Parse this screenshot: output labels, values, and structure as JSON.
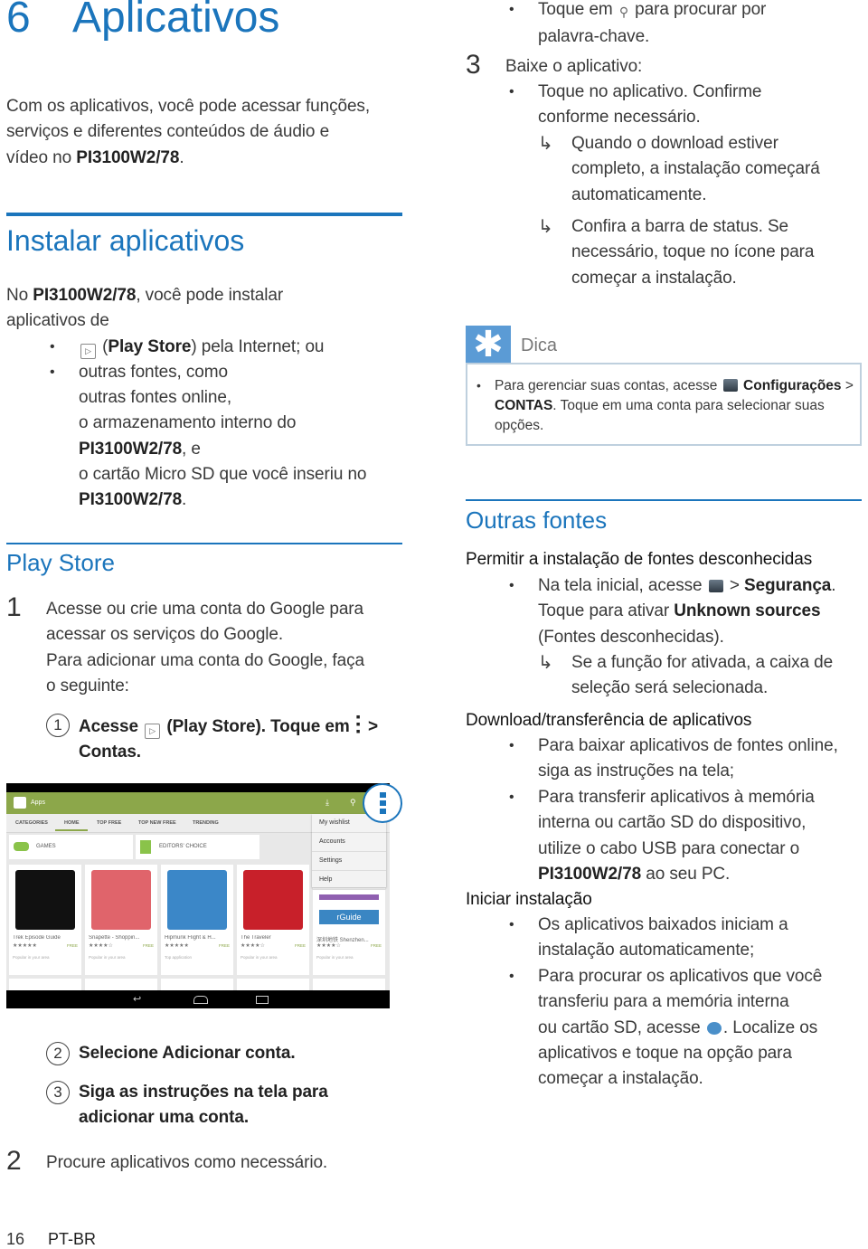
{
  "colors": {
    "accent": "#1b75bc",
    "tip_icon": "#5b9bd5",
    "store_bar": "#8ca74a"
  },
  "left": {
    "chapter_number": "6",
    "chapter_title": "Aplicativos",
    "intro": [
      [
        "Com os aplicativos, você pode acessar funções,"
      ],
      [
        "serviços e diferentes conteúdos de áudio e"
      ],
      [
        "vídeo no ",
        {
          "text": "PI3100W2/78",
          "bold": true
        },
        "."
      ]
    ],
    "install_heading": "Instalar aplicativos",
    "install_para": [
      [
        "No ",
        {
          "text": "PI3100W2/78",
          "bold": true
        },
        ", você pode instalar"
      ],
      [
        "aplicativos de"
      ]
    ],
    "install_item1": [
      [
        {
          "icon": "play-store-icon"
        },
        " (",
        {
          "text": "Play Store",
          "bold": true
        },
        ") pela Internet; ou"
      ]
    ],
    "install_item2": [
      [
        "outras fontes, como"
      ],
      [
        "outras fontes online,"
      ],
      [
        "o armazenamento interno do"
      ],
      [
        {
          "text": "PI3100W2/78",
          "bold": true
        },
        ", e"
      ],
      [
        "o cartão Micro SD que você inseriu no"
      ],
      [
        {
          "text": "PI3100W2/78",
          "bold": true
        },
        "."
      ]
    ],
    "playstore_heading": "Play Store",
    "step1_number": "1",
    "step1": [
      [
        "Acesse ou crie uma conta do Google para"
      ],
      [
        "acessar os serviços do Google."
      ],
      [
        "Para adicionar uma conta do Google, faça"
      ],
      [
        "o seguinte:"
      ]
    ],
    "sub1_number": "1",
    "sub1": [
      [
        {
          "text": "Acesse",
          "bold": true
        },
        " ",
        {
          "icon": "play-store-icon"
        },
        " ",
        {
          "text": "(Play Store). Toque em",
          "bold": true
        },
        " ",
        {
          "icon": "menu-icon"
        },
        " ",
        {
          "text": ">",
          "bold": true
        }
      ],
      [
        {
          "text": "Contas.",
          "bold": true
        }
      ]
    ],
    "sub2_number": "2",
    "sub2": [
      [
        {
          "text": "Selecione Adicionar conta.",
          "bold": true
        }
      ]
    ],
    "sub3_number": "3",
    "sub3": [
      [
        {
          "text": "Siga as instruções na tela para",
          "bold": true
        }
      ],
      [
        {
          "text": "adicionar uma conta.",
          "bold": true
        }
      ]
    ],
    "step2_number": "2",
    "step2": [
      [
        "Procure aplicativos como necessário."
      ]
    ]
  },
  "screenshot": {
    "title": "Apps",
    "tabs": [
      "CATEGORIES",
      "HOME",
      "TOP FREE",
      "TOP NEW FREE",
      "TRENDING"
    ],
    "categories": [
      "GAMES",
      "EDITORS' CHOICE"
    ],
    "menu": [
      "My wishlist",
      "Accounts",
      "Settings",
      "Help"
    ],
    "apps": [
      {
        "name": "Trek Episode Guide",
        "stars": "★★★★★",
        "price": "FREE",
        "note": "Popular in your area",
        "color": "#111"
      },
      {
        "name": "Snapette - Shoppin...",
        "stars": "★★★★☆",
        "price": "FREE",
        "note": "Popular in your area",
        "color": "#e0646b"
      },
      {
        "name": "Hipmunk Flight & H...",
        "stars": "★★★★★",
        "price": "FREE",
        "note": "Top application",
        "color": "#3b87c8"
      },
      {
        "name": "The Traveler",
        "stars": "★★★★☆",
        "price": "FREE",
        "note": "Popular in your area",
        "color": "#c8202a"
      },
      {
        "name": "深圳地铁 Shenzhen...",
        "stars": "★★★★☆",
        "price": "FREE",
        "note": "Popular in your area",
        "color": "#fff"
      }
    ],
    "app5_label": "rGuide",
    "app5_chars": "深圳"
  },
  "right": {
    "search_item": [
      [
        "Toque em ",
        {
          "icon": "search-icon"
        },
        " para procurar por"
      ],
      [
        "palavra-chave."
      ]
    ],
    "step3_number": "3",
    "step3": [
      [
        "Baixe o aplicativo:"
      ]
    ],
    "step3_item": [
      [
        "Toque no aplicativo. Confirme"
      ],
      [
        "conforme necessário."
      ]
    ],
    "step3_result1": [
      [
        "Quando o download estiver"
      ],
      [
        "completo, a instalação começará"
      ],
      [
        "automaticamente."
      ]
    ],
    "step3_result2": [
      [
        "Confira a barra de status. Se"
      ],
      [
        "necessário, toque no ícone para"
      ],
      [
        "começar a instalação."
      ]
    ],
    "tip_title": "Dica",
    "tip": [
      [
        "Para gerenciar suas contas, acesse ",
        {
          "icon": "settings-icon"
        },
        " ",
        {
          "text": "Configurações",
          "bold": true
        },
        " >"
      ],
      [
        {
          "text": "CONTAS",
          "bold": true
        },
        ". Toque em uma conta para selecionar suas"
      ],
      [
        "opções."
      ]
    ],
    "other_heading": "Outras fontes",
    "allow_heading": "Permitir a instalação de fontes desconhecidas",
    "allow_item": [
      [
        "Na tela inicial, acesse ",
        {
          "icon": "settings-icon"
        },
        " > ",
        {
          "text": "Segurança",
          "bold": true
        },
        "."
      ],
      [
        "Toque para ativar ",
        {
          "text": "Unknown sources",
          "bold": true
        }
      ],
      [
        "(Fontes desconhecidas)."
      ]
    ],
    "allow_result": [
      [
        "Se a função for ativada, a caixa de"
      ],
      [
        "seleção será selecionada."
      ]
    ],
    "download_heading": "Download/transferência de aplicativos",
    "download_item1": [
      [
        "Para baixar aplicativos de fontes online,"
      ],
      [
        "siga as instruções na tela;"
      ]
    ],
    "download_item2": [
      [
        "Para transferir aplicativos à memória"
      ],
      [
        "interna ou cartão SD do dispositivo,"
      ],
      [
        "utilize o cabo USB para conectar o"
      ],
      [
        {
          "text": "PI3100W2/78",
          "bold": true
        },
        " ao seu PC."
      ]
    ],
    "start_heading": "Iniciar instalação",
    "start_item1": [
      [
        "Os aplicativos baixados iniciam a"
      ],
      [
        "instalação automaticamente;"
      ]
    ],
    "start_item2": [
      [
        "Para procurar os aplicativos que você"
      ],
      [
        "transferiu para a memória interna"
      ],
      [
        "ou cartão SD, acesse ",
        {
          "icon": "file-manager-icon"
        },
        ". Localize os"
      ],
      [
        "aplicativos e toque na opção para"
      ],
      [
        "começar a instalação."
      ]
    ]
  },
  "footer": {
    "page_number": "16",
    "language": "PT-BR"
  },
  "symbols": {
    "bullet": "•",
    "arrow": "↳"
  }
}
